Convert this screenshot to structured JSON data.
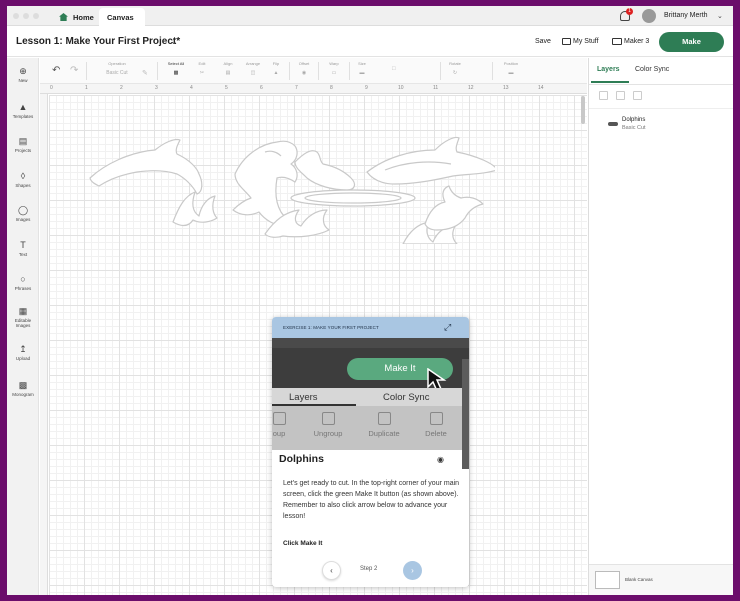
{
  "titlebar": {
    "tabs": [
      {
        "label": "Home",
        "icon": "home-icon"
      },
      {
        "label": "Canvas"
      }
    ],
    "notification_count": "1",
    "username": "Brittany Merth"
  },
  "header": {
    "project_title": "Lesson 1: Make Your First Project*",
    "save_label": "Save",
    "my_stuff_label": "My Stuff",
    "machine_label": "Maker 3",
    "make_label": "Make"
  },
  "sidebar": {
    "items": [
      {
        "label": "New",
        "icon": "plus-circle-icon"
      },
      {
        "label": "Templates",
        "icon": "shirt-icon"
      },
      {
        "label": "Projects",
        "icon": "projects-icon"
      },
      {
        "label": "Shapes",
        "icon": "shapes-icon"
      },
      {
        "label": "Images",
        "icon": "lightbulb-icon"
      },
      {
        "label": "Text",
        "icon": "text-icon"
      },
      {
        "label": "Phrases",
        "icon": "speech-bubble-icon"
      },
      {
        "label": "Editable Images",
        "icon": "editable-images-icon"
      },
      {
        "label": "Upload",
        "icon": "upload-icon"
      },
      {
        "label": "Monogram",
        "icon": "monogram-icon"
      }
    ]
  },
  "toolbar": {
    "operation_label": "Operation",
    "operation_value": "Basic Cut",
    "select_all_label": "Select All",
    "edit_label": "Edit",
    "align_label": "Align",
    "arrange_label": "Arrange",
    "flip_label": "Flip",
    "offset_label": "Offset",
    "warp_label": "Warp",
    "size_label": "Size",
    "rotate_label": "Rotate",
    "position_label": "Position"
  },
  "ruler": {
    "numbers": [
      "0",
      "1",
      "2",
      "3",
      "4",
      "5",
      "6",
      "7",
      "8",
      "9",
      "10",
      "11",
      "12",
      "13",
      "14"
    ]
  },
  "right_panel": {
    "tabs": [
      "Layers",
      "Color Sync"
    ],
    "layer": {
      "name": "Dolphins",
      "operation": "Basic Cut"
    },
    "blank_canvas_label": "Blank Canvas"
  },
  "exercise": {
    "header": "EXERCISE 1: MAKE YOUR FIRST PROJECT",
    "screenshot": {
      "make_label": "Make It",
      "tabs": [
        "Layers",
        "Color Sync"
      ],
      "tools": [
        "oup",
        "Ungroup",
        "Duplicate",
        "Delete"
      ],
      "layer_name": "Dolphins"
    },
    "body": "Let's get ready to cut. In the top-right corner of your main screen, click the green Make It button (as shown above). Remember to also click arrow below to advance your lesson!",
    "cta": "Click Make It",
    "step": "Step 2"
  },
  "colors": {
    "accent_green": "#2e7d55",
    "frame_purple": "#6b0d6b",
    "exercise_blue": "#a9c6e2"
  }
}
